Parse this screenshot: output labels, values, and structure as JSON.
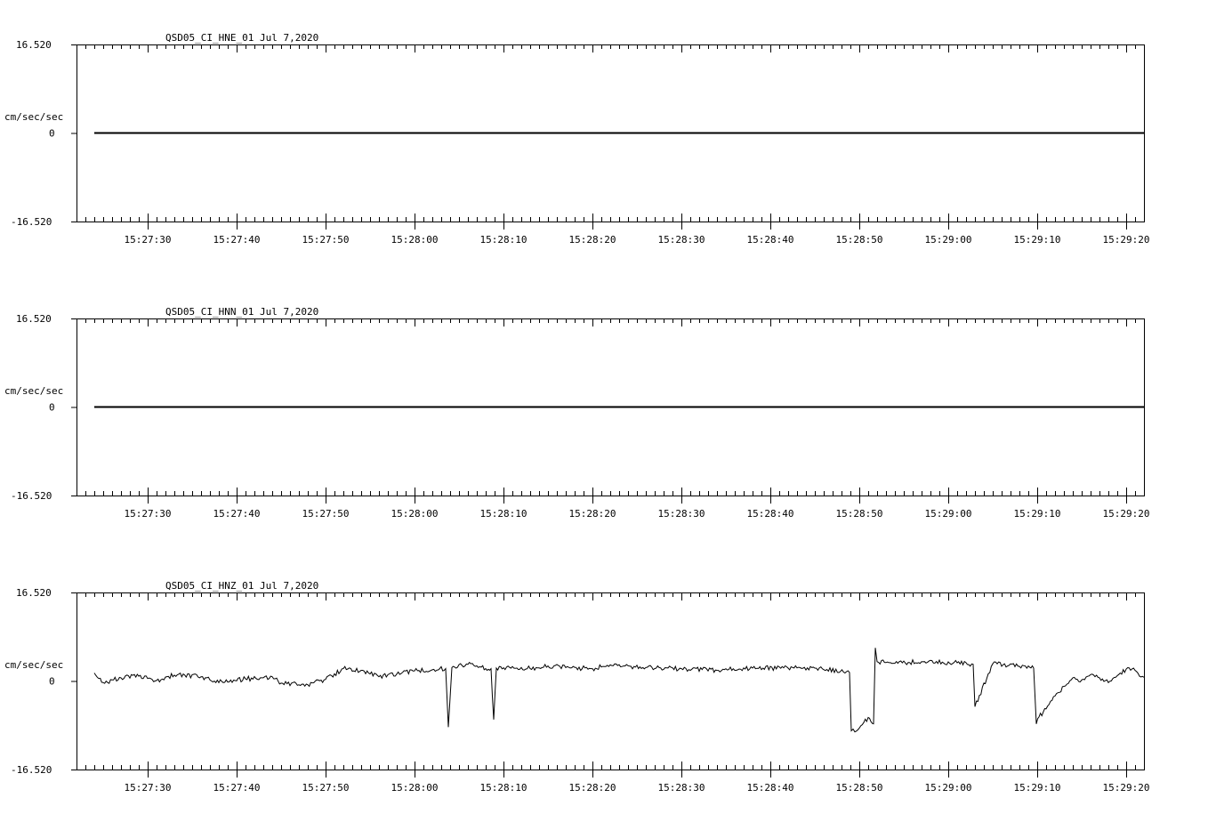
{
  "chart_data": [
    {
      "type": "line",
      "title": "QSD05_CI_HNE_01  Jul 7,2020",
      "ylabel": "cm/sec/sec",
      "ylim": [
        -16.52,
        16.52
      ],
      "yticks": [
        "16.520",
        "0",
        "-16.520"
      ],
      "xticks": [
        "15:27:30",
        "15:27:40",
        "15:27:50",
        "15:28:00",
        "15:28:10",
        "15:28:20",
        "15:28:30",
        "15:28:40",
        "15:28:50",
        "15:29:00",
        "15:29:10",
        "15:29:20"
      ],
      "xlim_seconds": [
        0,
        120
      ],
      "series": [
        {
          "x": [
            2,
            120
          ],
          "y": [
            0,
            0
          ]
        }
      ]
    },
    {
      "type": "line",
      "title": "QSD05_CI_HNN_01  Jul 7,2020",
      "ylabel": "cm/sec/sec",
      "ylim": [
        -16.52,
        16.52
      ],
      "yticks": [
        "16.520",
        "0",
        "-16.520"
      ],
      "xticks": [
        "15:27:30",
        "15:27:40",
        "15:27:50",
        "15:28:00",
        "15:28:10",
        "15:28:20",
        "15:28:30",
        "15:28:40",
        "15:28:50",
        "15:29:00",
        "15:29:10",
        "15:29:20"
      ],
      "xlim_seconds": [
        0,
        120
      ],
      "series": [
        {
          "x": [
            2,
            120
          ],
          "y": [
            0,
            0
          ]
        }
      ]
    },
    {
      "type": "line",
      "title": "QSD05_CI_HNZ_01  Jul 7,2020",
      "ylabel": "cm/sec/sec",
      "ylim": [
        -16.52,
        16.52
      ],
      "yticks": [
        "16.520",
        "0",
        "-16.520"
      ],
      "xticks": [
        "15:27:30",
        "15:27:40",
        "15:27:50",
        "15:28:00",
        "15:28:10",
        "15:28:20",
        "15:28:30",
        "15:28:40",
        "15:28:50",
        "15:29:00",
        "15:29:10",
        "15:29:20"
      ],
      "xlim_seconds": [
        0,
        120
      ],
      "series": [
        {
          "x": [
            2,
            3,
            5,
            7,
            9,
            11,
            14,
            15,
            17,
            19,
            21,
            22,
            23,
            26,
            28,
            30,
            32,
            34,
            36,
            38,
            40,
            41.5,
            41.8,
            42.2,
            42.5,
            44,
            46,
            46.6,
            46.9,
            47.2,
            49,
            51,
            53,
            55,
            58,
            60,
            64,
            68,
            72,
            76,
            80,
            83,
            86.9,
            87.1,
            87.5,
            88,
            89,
            89.6,
            89.8,
            90,
            92,
            95,
            99,
            100.8,
            101,
            103,
            107,
            107.6,
            107.9,
            108.2,
            109,
            110,
            111,
            112,
            113,
            114,
            115,
            116,
            117,
            118,
            119,
            120
          ],
          "y": [
            1.5,
            -0.3,
            0.6,
            0.9,
            0.1,
            1.1,
            0.8,
            0.2,
            -0.2,
            0.4,
            0.6,
            0.8,
            -0.4,
            -0.7,
            0.3,
            2.3,
            2.0,
            0.8,
            1.3,
            1.9,
            2.1,
            2.3,
            -8.6,
            2.5,
            2.6,
            3.1,
            2.3,
            2.3,
            -7.2,
            2.4,
            2.7,
            2.3,
            2.8,
            2.5,
            2.3,
            3.0,
            2.5,
            2.3,
            2.0,
            2.4,
            2.4,
            2.4,
            1.6,
            -9.3,
            -9.5,
            -8.8,
            -6.8,
            -8.0,
            6.2,
            3.6,
            3.3,
            3.6,
            3.4,
            3.1,
            -4.8,
            3.2,
            2.8,
            2.4,
            -8.0,
            -6.7,
            -5.2,
            -2.8,
            -1.0,
            0.6,
            0.2,
            1.2,
            0.6,
            -0.3,
            1.0,
            2.2,
            2.0,
            0.7
          ]
        }
      ]
    }
  ]
}
